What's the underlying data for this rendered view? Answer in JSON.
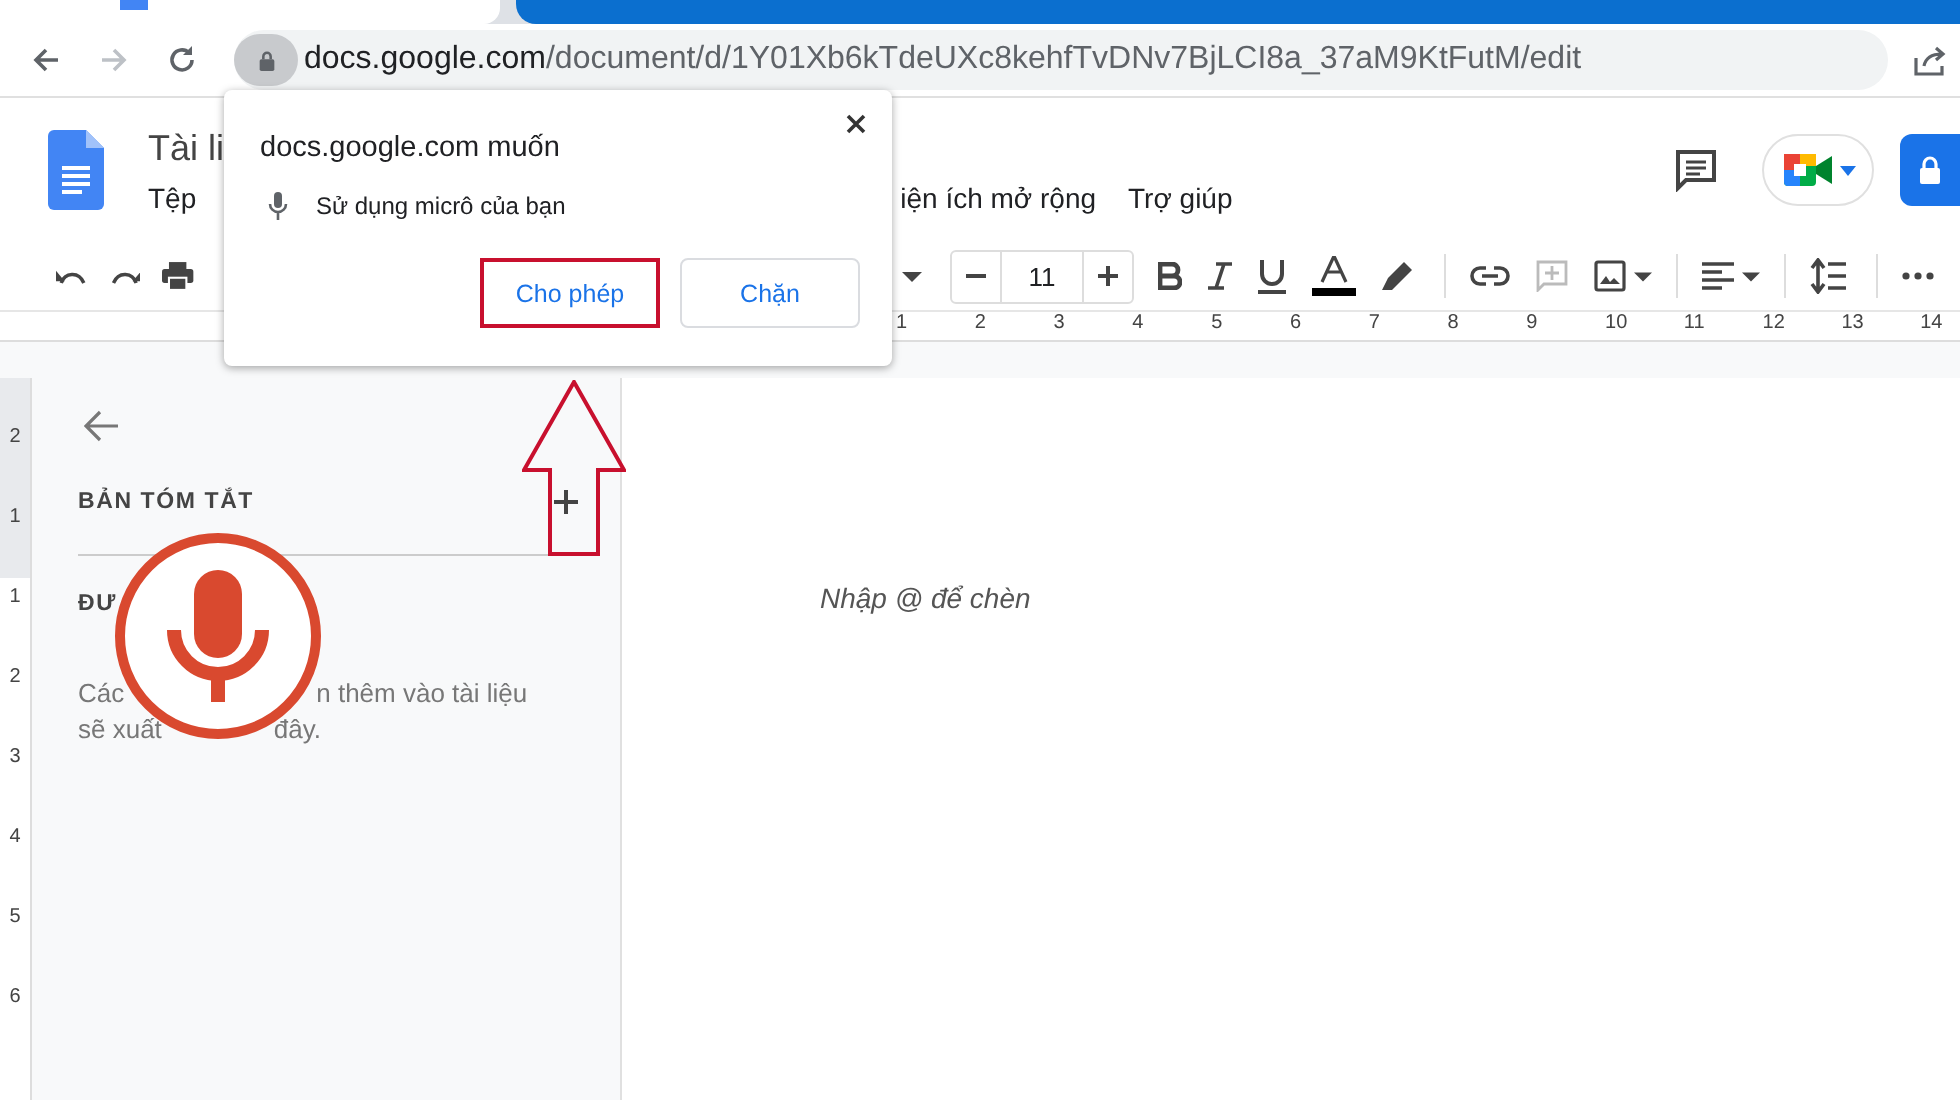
{
  "browser": {
    "url_host": "docs.google.com",
    "url_path": "/document/d/1Y01Xb6kTdeUXc8kehfTvDNv7BjLCI8a_37aM9KtFutM/edit"
  },
  "document": {
    "title": "Tài li",
    "menu": [
      "Tệp",
      "iện ích mở rộng",
      "Trợ giúp"
    ]
  },
  "toolbar": {
    "font_size": "11"
  },
  "ruler": [
    "1",
    "2",
    "3",
    "4",
    "5",
    "6",
    "7",
    "8",
    "9",
    "10",
    "11",
    "12",
    "13",
    "14"
  ],
  "vertical_ruler": [
    "2",
    "1",
    "1",
    "2",
    "3",
    "4",
    "5",
    "6"
  ],
  "permission_popup": {
    "title": "docs.google.com muốn",
    "permission": "Sử dụng micrô của bạn",
    "buttons": [
      {
        "label": "Cho phép",
        "highlighted": true
      },
      {
        "label": "Chặn",
        "highlighted": false
      }
    ]
  },
  "outline": {
    "heading": "BẢN TÓM TẮT",
    "section": "ĐƯ",
    "hint_parts": [
      "Các",
      "n thêm vào tài liệu",
      "sẽ xuất",
      "đây."
    ]
  },
  "page": {
    "hint": "Nhập @ để chèn"
  }
}
